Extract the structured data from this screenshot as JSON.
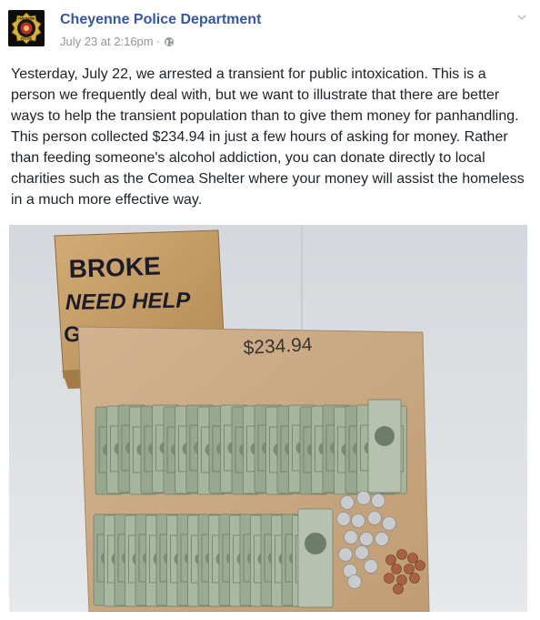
{
  "post": {
    "page_name": "Cheyenne Police Department",
    "timestamp": "July 23 at 2:16pm",
    "separator": "·",
    "audience_icon": "globe-icon",
    "menu_icon": "chevron-down-icon",
    "body": "Yesterday, July 22, we arrested a transient for public intoxication. This is a person we frequently deal with, but we want to illustrate that there are better ways to help the transient population than to give them money for panhandling. This person collected $234.94 in just a few hours of asking for money. Rather than feeding someone's alcohol addiction, you can donate directly to local charities such as the Comea Shelter where your money will assist the homeless in a much more effective way."
  },
  "avatar": {
    "badge_top_text": "CHEYENNE",
    "badge_bottom_text": "POLICE"
  },
  "photo": {
    "sign_lines": [
      "BROKE",
      "NEED HELP",
      "GOD BLESS"
    ],
    "amount_label": "$234.94",
    "colors": {
      "wall": "#dcdfe3",
      "table": "#ececec",
      "cardboard": "#c7a06a",
      "envelope": "#c9ab86",
      "bill": "#9eae95"
    }
  }
}
